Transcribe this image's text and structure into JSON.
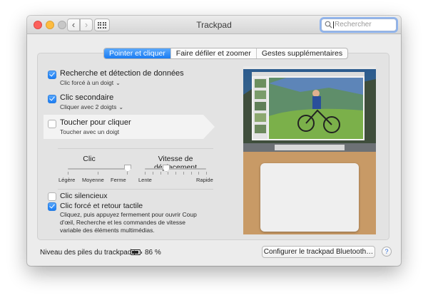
{
  "window": {
    "title": "Trackpad"
  },
  "search": {
    "placeholder": "Rechercher"
  },
  "tabs": [
    {
      "label": "Pointer et cliquer",
      "active": true
    },
    {
      "label": "Faire défiler et zoomer",
      "active": false
    },
    {
      "label": "Gestes supplémentaires",
      "active": false
    }
  ],
  "options": [
    {
      "label": "Recherche et détection de données",
      "sub": "Clic forcé à un doigt",
      "checked": true,
      "has_menu": true
    },
    {
      "label": "Clic secondaire",
      "sub": "Cliquer avec 2 doigts",
      "checked": true,
      "has_menu": true
    },
    {
      "label": "Toucher pour cliquer",
      "sub": "Toucher avec un doigt",
      "checked": false,
      "has_menu": false
    }
  ],
  "sliders": {
    "click": {
      "title": "Clic",
      "labels": [
        "Légère",
        "Moyenne",
        "Ferme"
      ],
      "value_index": 2
    },
    "speed": {
      "title": "Vitesse de déplacement",
      "min_label": "Lente",
      "max_label": "Rapide",
      "value_fraction": 0.35
    }
  },
  "silent_click": {
    "label": "Clic silencieux",
    "checked": false
  },
  "force_click": {
    "label": "Clic forcé et retour tactile",
    "checked": true,
    "description": "Cliquez, puis appuyez fermement pour ouvrir Coup d'œil, Recherche et les commandes de vitesse variable des éléments multimédias."
  },
  "battery": {
    "label": "Niveau des piles du trackpad :",
    "percent": "86 %"
  },
  "config_button": {
    "label": "Configurer le trackpad Bluetooth…"
  },
  "help": {
    "label": "?"
  },
  "colors": {
    "accent": "#1a7cf3",
    "panel": "#e3e3e3",
    "window": "#ececec"
  }
}
